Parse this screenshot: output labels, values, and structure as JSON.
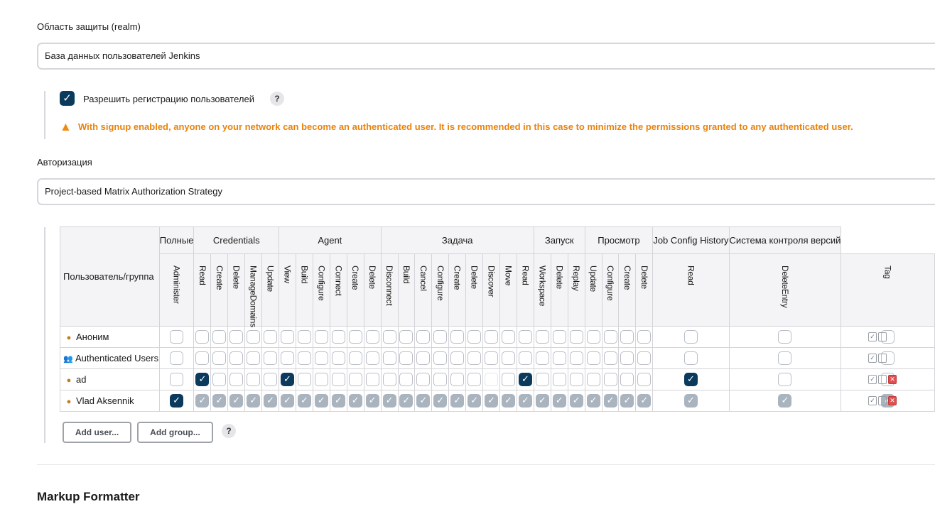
{
  "realm": {
    "label": "Область защиты (realm)",
    "value": "База данных пользователей Jenkins",
    "signup_label": "Разрешить регистрацию пользователей",
    "signup_checked": true,
    "help": "?",
    "warning_icon": "warning-triangle-icon",
    "warning": "With signup enabled, anyone on your network can become an authenticated user. It is recommended in this case to minimize the permissions granted to any authenticated user."
  },
  "authorization": {
    "label": "Авторизация",
    "value": "Project-based Matrix Authorization Strategy"
  },
  "matrix": {
    "user_group_header": "Пользователь/группа",
    "groups": [
      {
        "name": "Полные",
        "span": 1
      },
      {
        "name": "Credentials",
        "span": 5
      },
      {
        "name": "Agent",
        "span": 6
      },
      {
        "name": "Задача",
        "span": 9
      },
      {
        "name": "Запуск",
        "span": 3
      },
      {
        "name": "Просмотр",
        "span": 4
      },
      {
        "name": "Job Config History",
        "span": 1
      },
      {
        "name": "Система контроля версий",
        "span": 1
      }
    ],
    "permissions": [
      "Administer",
      "Read",
      "Create",
      "Delete",
      "ManageDomains",
      "Update",
      "View",
      "Build",
      "Configure",
      "Connect",
      "Create",
      "Delete",
      "Disconnect",
      "Build",
      "Cancel",
      "Configure",
      "Create",
      "Delete",
      "Discover",
      "Move",
      "Read",
      "Workspace",
      "Delete",
      "Replay",
      "Update",
      "Configure",
      "Create",
      "Delete",
      "Read",
      "DeleteEntry",
      "Tag"
    ],
    "rows": [
      {
        "name": "Аноним",
        "icon": "user-icon",
        "checked": [],
        "inherited": [],
        "faint": [],
        "deletable": false
      },
      {
        "name": "Authenticated Users",
        "icon": "group-icon",
        "checked": [],
        "inherited": [],
        "faint": [],
        "deletable": false
      },
      {
        "name": "ad",
        "icon": "user-icon",
        "checked": [
          1,
          6,
          20,
          28
        ],
        "inherited": [],
        "faint": [
          18
        ],
        "deletable": true
      },
      {
        "name": "Vlad Aksennik",
        "icon": "user-icon",
        "checked": [
          0
        ],
        "inherited": [
          1,
          2,
          3,
          4,
          5,
          6,
          7,
          8,
          9,
          10,
          11,
          12,
          13,
          14,
          15,
          16,
          17,
          18,
          19,
          20,
          21,
          22,
          23,
          24,
          25,
          26,
          27,
          28,
          29,
          30
        ],
        "faint": [],
        "deletable": true
      }
    ],
    "add_user": "Add user...",
    "add_group": "Add group..."
  },
  "markup_formatter": {
    "title": "Markup Formatter"
  }
}
